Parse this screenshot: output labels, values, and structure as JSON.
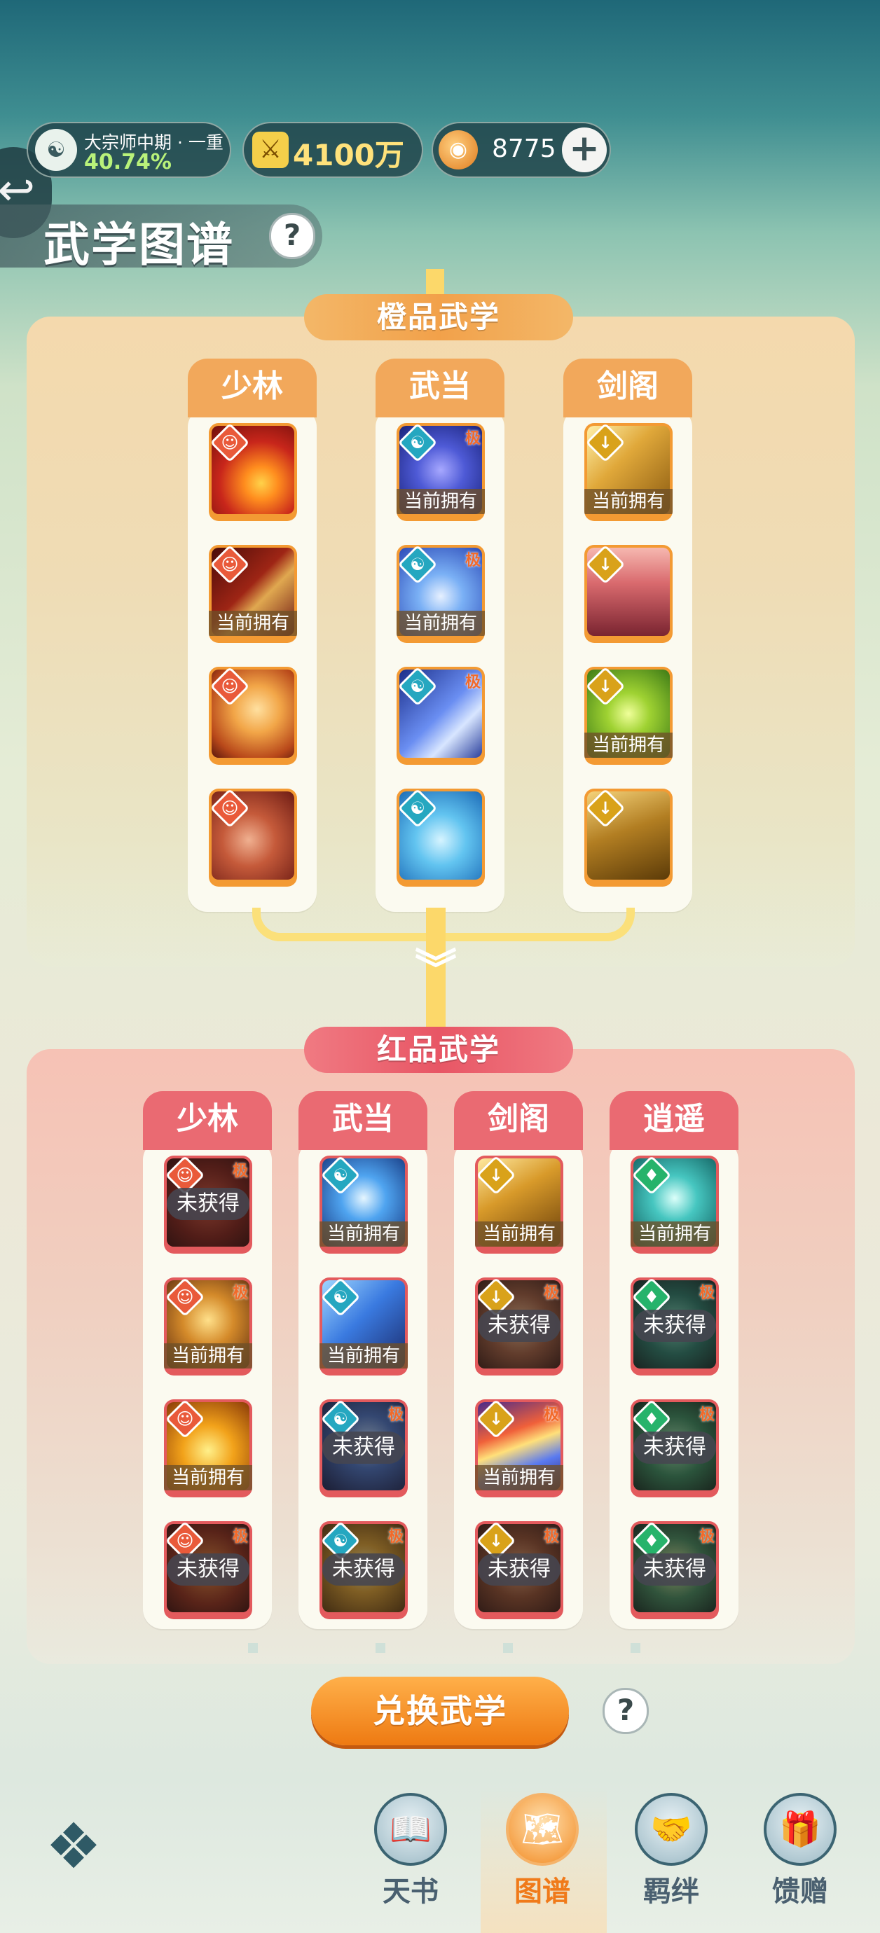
{
  "status_bar": {
    "rank_title": "大宗师中期 · 一重",
    "rank_progress": "40.74%",
    "power_value": "4100万",
    "coin_value": "8775",
    "plus_label": "+"
  },
  "header": {
    "title": "武学图谱",
    "help_label": "?"
  },
  "orange_section": {
    "title": "橙品武学",
    "columns": [
      {
        "name": "少林",
        "school": "shaolin",
        "items": [
          {
            "owned": false,
            "ji": false,
            "art": "a-fire"
          },
          {
            "owned": true,
            "ji": false,
            "art": "a-fire2"
          },
          {
            "owned": false,
            "ji": false,
            "art": "a-palm"
          },
          {
            "owned": false,
            "ji": false,
            "art": "a-fist"
          }
        ]
      },
      {
        "name": "武当",
        "school": "wudang",
        "items": [
          {
            "owned": true,
            "ji": true,
            "art": "a-blue1"
          },
          {
            "owned": true,
            "ji": true,
            "art": "a-blue2"
          },
          {
            "owned": false,
            "ji": true,
            "art": "a-blue3"
          },
          {
            "owned": false,
            "ji": false,
            "art": "a-blue4"
          }
        ]
      },
      {
        "name": "剑阁",
        "school": "jiange",
        "items": [
          {
            "owned": true,
            "ji": false,
            "art": "a-gold1"
          },
          {
            "owned": false,
            "ji": false,
            "art": "a-pinkswords"
          },
          {
            "owned": true,
            "ji": false,
            "art": "a-green"
          },
          {
            "owned": false,
            "ji": false,
            "art": "a-gold2"
          }
        ]
      }
    ]
  },
  "red_section": {
    "title": "红品武学",
    "columns": [
      {
        "name": "少林",
        "school": "shaolin",
        "items": [
          {
            "state": "locked",
            "ji": true,
            "art": "a-red1"
          },
          {
            "state": "owned",
            "ji": true,
            "art": "a-gold-buddha"
          },
          {
            "state": "owned",
            "ji": false,
            "art": "a-lion"
          },
          {
            "state": "locked",
            "ji": true,
            "art": "a-redhands"
          }
        ]
      },
      {
        "name": "武当",
        "school": "wudang",
        "items": [
          {
            "state": "owned",
            "ji": false,
            "art": "a-ice"
          },
          {
            "state": "owned",
            "ji": false,
            "art": "a-blueblocks"
          },
          {
            "state": "locked",
            "ji": true,
            "art": "a-bluestorm"
          },
          {
            "state": "locked",
            "ji": true,
            "art": "a-goldstorm"
          }
        ]
      },
      {
        "name": "剑阁",
        "school": "jiange",
        "items": [
          {
            "state": "owned",
            "ji": false,
            "art": "a-goldswords"
          },
          {
            "state": "locked",
            "ji": true,
            "art": "a-browndance"
          },
          {
            "state": "owned",
            "ji": true,
            "art": "a-comet"
          },
          {
            "state": "locked",
            "ji": true,
            "art": "a-brownsword"
          }
        ]
      },
      {
        "name": "逍遥",
        "school": "xiaoyao",
        "items": [
          {
            "state": "owned",
            "ji": false,
            "art": "a-teal1"
          },
          {
            "state": "locked",
            "ji": true,
            "art": "a-teal2"
          },
          {
            "state": "locked",
            "ji": true,
            "art": "a-teal3"
          },
          {
            "state": "locked",
            "ji": true,
            "art": "a-teal4"
          }
        ]
      }
    ]
  },
  "labels": {
    "owned": "当前拥有",
    "locked": "未获得",
    "ji": "极"
  },
  "school_icons": {
    "shaolin": "shaolin-monk-icon",
    "wudang": "wudang-taiji-icon",
    "jiange": "jiange-sword-icon",
    "xiaoyao": "xiaoyao-leaf-icon"
  },
  "exchange_button": "兑换武学",
  "bottom_nav": {
    "items": [
      {
        "label": "天书",
        "icon": "book-icon",
        "selected": false
      },
      {
        "label": "图谱",
        "icon": "map-scroll-icon",
        "selected": true
      },
      {
        "label": "羁绊",
        "icon": "handshake-icon",
        "selected": false
      },
      {
        "label": "馈赠",
        "icon": "gift-icon",
        "selected": false
      }
    ]
  },
  "colors": {
    "orange_accent": "#f2a85b",
    "red_accent": "#ea6a72",
    "selected_nav": "#f07a1a"
  }
}
